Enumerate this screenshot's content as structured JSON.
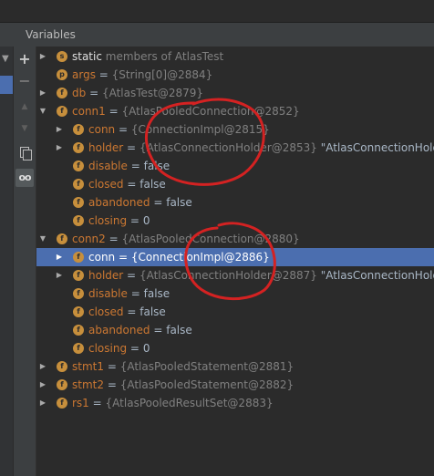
{
  "panel": {
    "title": "Variables"
  },
  "toolbar": {
    "add_label": "+",
    "remove_label": "−",
    "up_label": "▲",
    "down_label": "▼",
    "watch_label": "oo"
  },
  "annotation_color": "#d42222",
  "rows": [
    {
      "name": "static",
      "eq": "",
      "value": "members of AtlasTest"
    },
    {
      "name": "args",
      "eq": "=",
      "value": "{String[0]@2884}"
    },
    {
      "name": "db",
      "eq": "=",
      "value": "{AtlasTest@2879}"
    },
    {
      "name": "conn1",
      "eq": "=",
      "value": "{AtlasPooledConnection@2852}"
    },
    {
      "name": "conn",
      "eq": "=",
      "value": "{ConnectionImpl@2815}"
    },
    {
      "name": "holder",
      "eq": "=",
      "value": "{AtlasConnectionHolder@2853}",
      "extra": "\"AtlasConnectionHolder"
    },
    {
      "name": "disable",
      "eq": "=",
      "value": "false"
    },
    {
      "name": "closed",
      "eq": "=",
      "value": "false"
    },
    {
      "name": "abandoned",
      "eq": "=",
      "value": "false"
    },
    {
      "name": "closing",
      "eq": "=",
      "value": "0"
    },
    {
      "name": "conn2",
      "eq": "=",
      "value": "{AtlasPooledConnection@2880}"
    },
    {
      "name": "conn",
      "eq": "=",
      "value": "{ConnectionImpl@2886}"
    },
    {
      "name": "holder",
      "eq": "=",
      "value": "{AtlasConnectionHolder@2887}",
      "extra": "\"AtlasConnectionHolder"
    },
    {
      "name": "disable",
      "eq": "=",
      "value": "false"
    },
    {
      "name": "closed",
      "eq": "=",
      "value": "false"
    },
    {
      "name": "abandoned",
      "eq": "=",
      "value": "false"
    },
    {
      "name": "closing",
      "eq": "=",
      "value": "0"
    },
    {
      "name": "stmt1",
      "eq": "=",
      "value": "{AtlasPooledStatement@2881}"
    },
    {
      "name": "stmt2",
      "eq": "=",
      "value": "{AtlasPooledStatement@2882}"
    },
    {
      "name": "rs1",
      "eq": "=",
      "value": "{AtlasPooledResultSet@2883}"
    }
  ]
}
